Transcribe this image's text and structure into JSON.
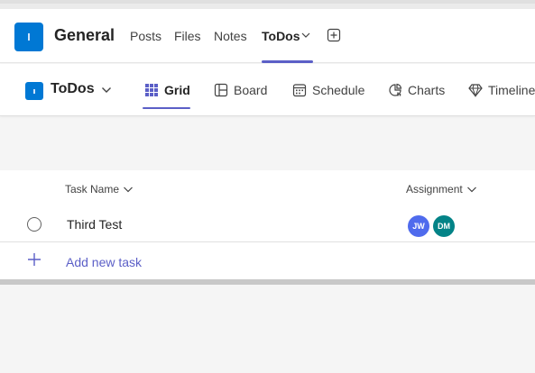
{
  "channel": {
    "name": "General",
    "tabs": [
      {
        "label": "Posts"
      },
      {
        "label": "Files"
      },
      {
        "label": "Notes"
      },
      {
        "label": "ToDos"
      }
    ]
  },
  "app": {
    "plan_name": "ToDos",
    "views": [
      {
        "label": "Grid"
      },
      {
        "label": "Board"
      },
      {
        "label": "Schedule"
      },
      {
        "label": "Charts"
      },
      {
        "label": "Timeline"
      }
    ]
  },
  "grid": {
    "columns": {
      "task_name": "Task Name",
      "assignment": "Assignment"
    },
    "tasks": [
      {
        "name": "Third Test",
        "assignees": [
          {
            "initials": "JW",
            "color": "#4f6bed"
          },
          {
            "initials": "DM",
            "color": "#038387"
          }
        ]
      }
    ],
    "add_new_task": "Add new task"
  },
  "colors": {
    "accent": "#5b5fc7",
    "brand_blue": "#0078d4"
  }
}
